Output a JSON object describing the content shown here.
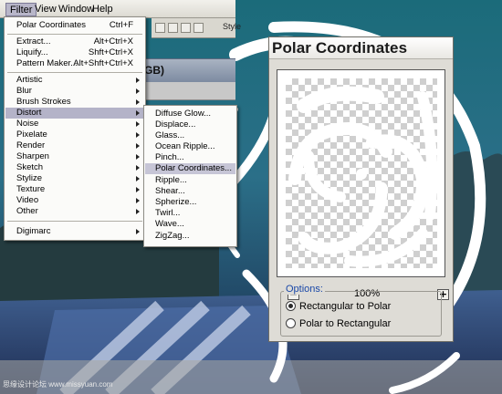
{
  "menubar": {
    "items": [
      {
        "label": "Filter",
        "active": true
      },
      {
        "label": "View",
        "active": false
      },
      {
        "label": "Window",
        "active": false
      },
      {
        "label": "Help",
        "active": false
      }
    ]
  },
  "options_bar": {
    "label": "Style"
  },
  "document": {
    "title_fragment": "GB)"
  },
  "filter_menu": {
    "last_filter": {
      "label": "Polar Coordinates",
      "shortcut": "Ctrl+F"
    },
    "items_group1": [
      {
        "label": "Extract...",
        "shortcut": "Alt+Ctrl+X"
      },
      {
        "label": "Liquify...",
        "shortcut": "Shft+Ctrl+X"
      },
      {
        "label": "Pattern Maker...",
        "shortcut": "Alt+Shft+Ctrl+X"
      }
    ],
    "submenus": [
      {
        "label": "Artistic"
      },
      {
        "label": "Blur"
      },
      {
        "label": "Brush Strokes"
      },
      {
        "label": "Distort"
      },
      {
        "label": "Noise"
      },
      {
        "label": "Pixelate"
      },
      {
        "label": "Render"
      },
      {
        "label": "Sharpen"
      },
      {
        "label": "Sketch"
      },
      {
        "label": "Stylize"
      },
      {
        "label": "Texture"
      },
      {
        "label": "Video"
      },
      {
        "label": "Other"
      }
    ],
    "highlighted": "Distort",
    "extra": {
      "label": "Digimarc"
    }
  },
  "distort_menu": {
    "items": [
      {
        "label": "Diffuse Glow..."
      },
      {
        "label": "Displace..."
      },
      {
        "label": "Glass..."
      },
      {
        "label": "Ocean Ripple..."
      },
      {
        "label": "Pinch..."
      },
      {
        "label": "Polar Coordinates..."
      },
      {
        "label": "Ripple..."
      },
      {
        "label": "Shear..."
      },
      {
        "label": "Spherize..."
      },
      {
        "label": "Twirl..."
      },
      {
        "label": "Wave..."
      },
      {
        "label": "ZigZag..."
      }
    ],
    "highlighted": "Polar Coordinates..."
  },
  "dialog": {
    "title": "Polar Coordinates",
    "zoom_out": "−",
    "zoom_in": "+",
    "zoom_level": "100%",
    "options_label": "Options:",
    "radio_options": [
      {
        "label": "Rectangular to Polar",
        "selected": true
      },
      {
        "label": "Polar to Rectangular",
        "selected": false
      }
    ]
  },
  "watermark": "思缘设计论坛 www.missyuan.com",
  "colors": {
    "menu_highlight": "#b4b3c8",
    "options_label": "#1b49a8",
    "dialog_bg": "#dedcd6"
  }
}
